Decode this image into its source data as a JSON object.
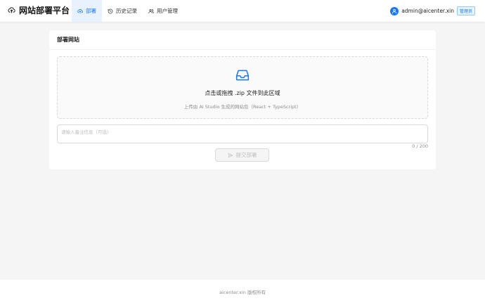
{
  "app": {
    "title": "网站部署平台",
    "logo_icon": "cloud-upload-icon"
  },
  "nav": [
    {
      "label": "部署",
      "icon": "cloud-upload-icon",
      "active": true
    },
    {
      "label": "历史记录",
      "icon": "history-icon",
      "active": false
    },
    {
      "label": "用户管理",
      "icon": "team-icon",
      "active": false
    }
  ],
  "user": {
    "email": "admin@aicenter.xin",
    "role": "管理员",
    "avatar_icon": "user-icon"
  },
  "card": {
    "title": "部署网站"
  },
  "upload": {
    "icon": "inbox-icon",
    "title": "点击或拖拽 .zip 文件到此区域",
    "hint": "上传由 AI Studio 生成的网站包（React + TypeScript）"
  },
  "note": {
    "placeholder": "请输入备注信息（可选）",
    "value": "",
    "counter": "0 / 200"
  },
  "submit": {
    "label": "提交部署",
    "icon": "send-icon",
    "disabled": true
  },
  "footer": {
    "text": "aicenter.xin 版权所有"
  },
  "colors": {
    "accent": "#1677ff",
    "nav_active_bg": "#e8f2ff",
    "page_bg": "#f5f5f5"
  }
}
